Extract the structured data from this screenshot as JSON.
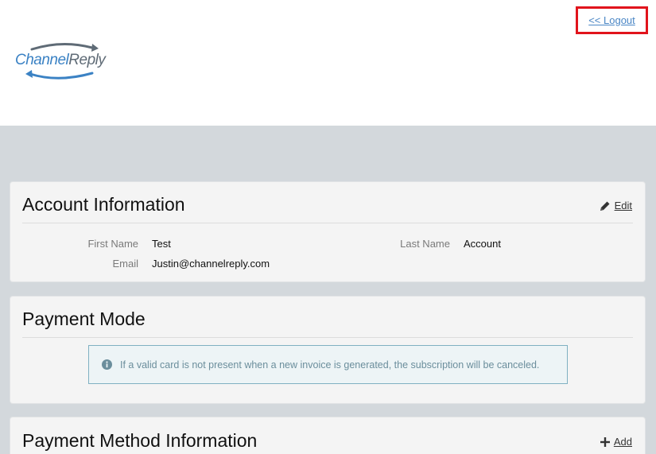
{
  "header": {
    "logo": {
      "part1": "Channel",
      "part2": "Reply"
    },
    "logout_label": "<< Logout"
  },
  "account": {
    "title": "Account Information",
    "edit_label": "Edit",
    "first_name_label": "First Name",
    "first_name_value": "Test",
    "last_name_label": "Last Name",
    "last_name_value": "Account",
    "email_label": "Email",
    "email_value": "Justin@channelreply.com"
  },
  "payment_mode": {
    "title": "Payment Mode",
    "alert_text": "If a valid card is not present when a new invoice is generated, the subscription will be canceled."
  },
  "payment_method": {
    "title": "Payment Method Information",
    "add_label": "Add"
  },
  "colors": {
    "background": "#d3d8dc",
    "card": "#f4f4f4",
    "link": "#4a86c5",
    "highlight": "#e1141c",
    "alert_border": "#7fb0c2"
  }
}
